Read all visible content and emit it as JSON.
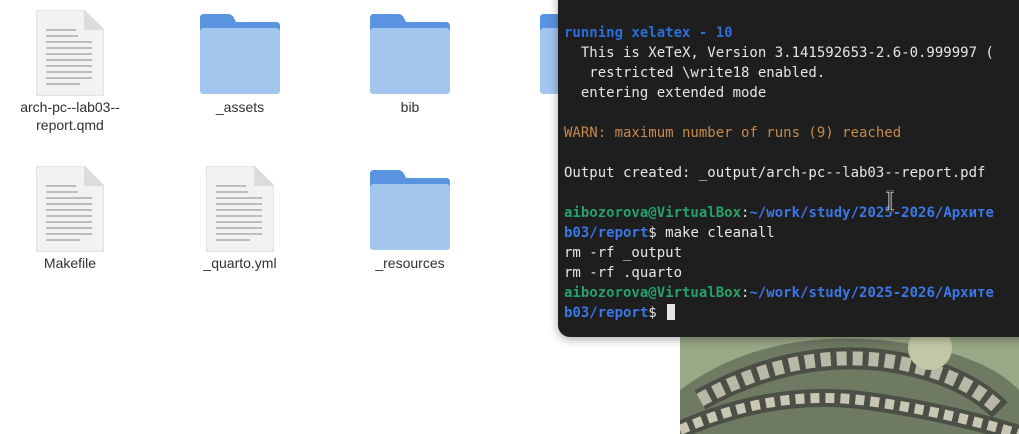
{
  "files": [
    {
      "name": "arch-pc--lab03--\nreport.qmd",
      "type": "document"
    },
    {
      "name": "_assets",
      "type": "folder"
    },
    {
      "name": "bib",
      "type": "folder"
    },
    {
      "name": "Makefile",
      "type": "document"
    },
    {
      "name": "_quarto.yml",
      "type": "document"
    },
    {
      "name": "_resources",
      "type": "folder"
    }
  ],
  "terminal": {
    "lines": [
      {
        "segments": [
          {
            "text": "running xelatex - 10",
            "style": "blue"
          }
        ]
      },
      {
        "segments": [
          {
            "text": "  This is XeTeX, Version 3.141592653-2.6-0.999997 (",
            "style": "plain"
          }
        ]
      },
      {
        "segments": [
          {
            "text": "   restricted \\write18 enabled.",
            "style": "plain"
          }
        ]
      },
      {
        "segments": [
          {
            "text": "  entering extended mode",
            "style": "plain"
          }
        ]
      },
      {
        "segments": [
          {
            "text": "",
            "style": "plain"
          }
        ]
      },
      {
        "segments": [
          {
            "text": "WARN: maximum number of runs (9) reached",
            "style": "warn"
          }
        ]
      },
      {
        "segments": [
          {
            "text": "",
            "style": "plain"
          }
        ]
      },
      {
        "segments": [
          {
            "text": "Output created: _output/arch-pc--lab03--report.pdf",
            "style": "plain"
          }
        ]
      },
      {
        "segments": [
          {
            "text": "",
            "style": "plain"
          }
        ]
      },
      {
        "segments": [
          {
            "text": "aibozorova@VirtualBox",
            "style": "green"
          },
          {
            "text": ":",
            "style": "plain"
          },
          {
            "text": "~/work/study/2025-2026/Архите",
            "style": "path"
          }
        ]
      },
      {
        "segments": [
          {
            "text": "b03/report",
            "style": "path"
          },
          {
            "text": "$ make cleanall",
            "style": "plain"
          }
        ]
      },
      {
        "segments": [
          {
            "text": "rm -rf _output",
            "style": "plain"
          }
        ]
      },
      {
        "segments": [
          {
            "text": "rm -rf .quarto",
            "style": "plain"
          }
        ]
      },
      {
        "segments": [
          {
            "text": "aibozorova@VirtualBox",
            "style": "green"
          },
          {
            "text": ":",
            "style": "plain"
          },
          {
            "text": "~/work/study/2025-2026/Архите",
            "style": "path"
          }
        ]
      },
      {
        "segments": [
          {
            "text": "b03/report",
            "style": "path"
          },
          {
            "text": "$ ",
            "style": "plain"
          }
        ],
        "cursor": true
      }
    ]
  },
  "colors": {
    "terminal_bg": "#1e1e1e",
    "folder": "#a3c6ef",
    "folder_tab": "#5a94e0",
    "prompt_user": "#26a269",
    "prompt_path": "#3b78e7",
    "warn": "#c58a4b",
    "heading": "#2b6fd6"
  }
}
